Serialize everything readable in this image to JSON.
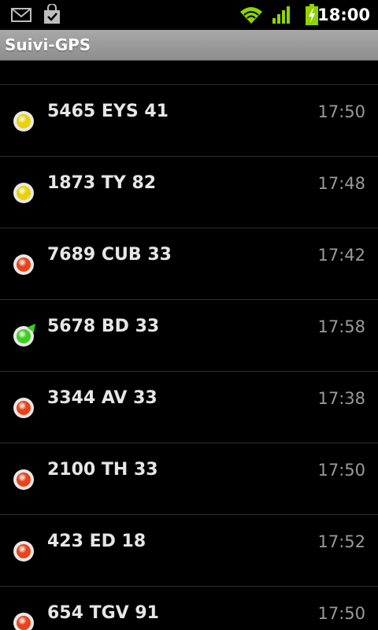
{
  "status_bar": {
    "time": "18:00",
    "icons": [
      "gmail-icon",
      "market-download-icon",
      "wifi-icon",
      "signal-icon",
      "battery-charging-icon"
    ]
  },
  "app": {
    "title": "Suivi-GPS"
  },
  "colors": {
    "yellow": "#e8d300",
    "red": "#e8431a",
    "green": "#3ccf1e",
    "battery": "#8fd400"
  },
  "vehicles": [
    {
      "plate": "5465 EYS 41",
      "time": "17:50",
      "status": "yellow"
    },
    {
      "plate": "1873 TY 82",
      "time": "17:48",
      "status": "yellow"
    },
    {
      "plate": "7689 CUB 33",
      "time": "17:42",
      "status": "red"
    },
    {
      "plate": "5678 BD 33",
      "time": "17:58",
      "status": "green-moving"
    },
    {
      "plate": "3344 AV 33",
      "time": "17:38",
      "status": "red"
    },
    {
      "plate": "2100 TH 33",
      "time": "17:50",
      "status": "red"
    },
    {
      "plate": "423 ED 18",
      "time": "17:52",
      "status": "red"
    },
    {
      "plate": "654 TGV 91",
      "time": "17:50",
      "status": "red"
    }
  ]
}
